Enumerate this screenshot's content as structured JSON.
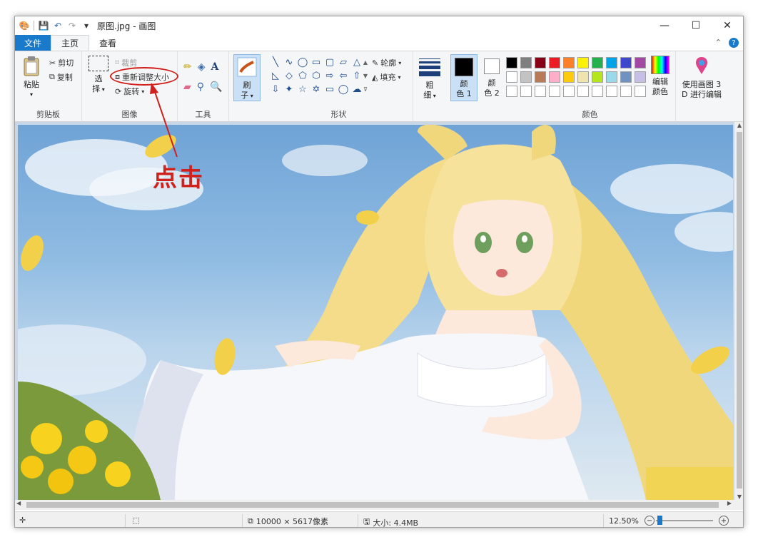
{
  "window": {
    "title": "原图.jpg - 画图",
    "controls": [
      "—",
      "☐",
      "✕"
    ]
  },
  "tabs": {
    "file": "文件",
    "home": "主页",
    "view": "查看"
  },
  "ribbon": {
    "clipboard": {
      "paste": "粘贴",
      "cut": "剪切",
      "copy": "复制",
      "label": "剪贴板"
    },
    "image": {
      "select_top": "选",
      "select_bottom": "择",
      "crop": "裁剪",
      "resize": "重新调整大小",
      "rotate": "旋转",
      "label": "图像"
    },
    "tools": {
      "label": "工具"
    },
    "brush": {
      "top": "刷",
      "bottom": "子"
    },
    "shapes": {
      "outline": "轮廓",
      "fill": "填充",
      "label": "形状"
    },
    "size": {
      "top": "粗",
      "bottom": "细"
    },
    "color1": {
      "top": "颜",
      "bottom": "色 1"
    },
    "color2": {
      "top": "颜",
      "bottom": "色 2"
    },
    "edit_colors": {
      "top": "编辑",
      "bottom": "颜色"
    },
    "paint3d": {
      "top": "使用画图 3",
      "bottom": "D 进行编辑"
    },
    "colors_label": "颜色",
    "palette": [
      "#000000",
      "#7f7f7f",
      "#880015",
      "#ed1c24",
      "#ff7f27",
      "#fff200",
      "#22b14c",
      "#00a2e8",
      "#3f48cc",
      "#a349a4",
      "#ffffff",
      "#c3c3c3",
      "#b97a57",
      "#ffaec9",
      "#ffc90e",
      "#efe4b0",
      "#b5e61d",
      "#99d9ea",
      "#7092be",
      "#c8bfe7",
      "#ffffff",
      "#ffffff",
      "#ffffff",
      "#ffffff",
      "#ffffff",
      "#ffffff",
      "#ffffff",
      "#ffffff",
      "#ffffff",
      "#ffffff"
    ],
    "shape_glyphs": [
      "╲",
      "∿",
      "◯",
      "▭",
      "▢",
      "▱",
      "△",
      "◺",
      "◇",
      "⬠",
      "⬡",
      "⇨",
      "⇦",
      "⇧",
      "⇩",
      "✦",
      "☆",
      "✡",
      "▭",
      "◯",
      "☁"
    ]
  },
  "annotation": {
    "text": "点击"
  },
  "status": {
    "dimensions": "10000 × 5617像素",
    "size": "大小: 4.4MB",
    "zoom": "12.50%"
  },
  "colors": {
    "accent": "#1979ca",
    "annotation": "#d0211c"
  }
}
